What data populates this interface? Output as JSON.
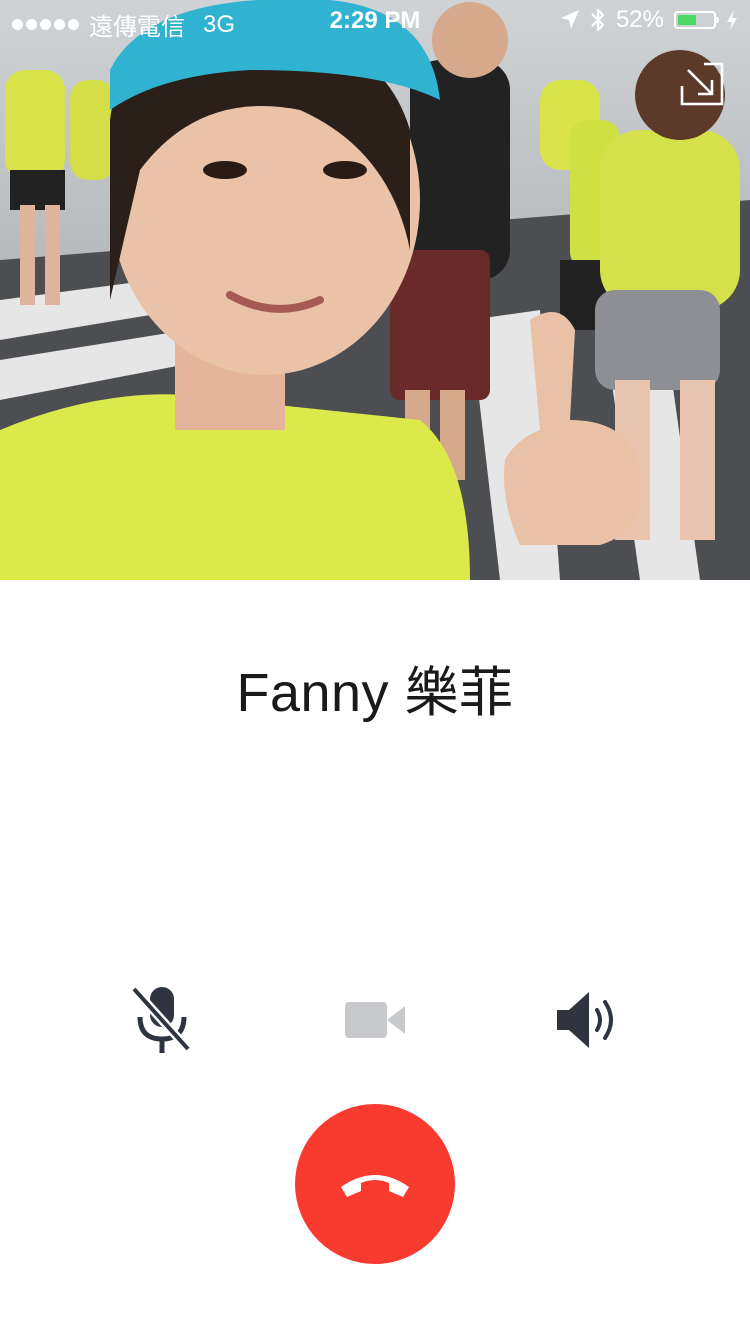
{
  "status_bar": {
    "carrier": "遠傳電信",
    "network": "3G",
    "time": "2:29 PM",
    "battery_percent_label": "52%",
    "battery_level": 0.52,
    "icons": [
      "signal-dots-icon",
      "location-arrow-icon",
      "bluetooth-icon",
      "battery-icon",
      "charging-bolt-icon"
    ]
  },
  "call": {
    "caller_name": "Fanny 樂菲"
  },
  "controls": {
    "mute": {
      "icon": "microphone-muted-icon"
    },
    "video": {
      "icon": "video-camera-icon"
    },
    "speaker": {
      "icon": "speaker-icon"
    },
    "end_call": {
      "icon": "phone-hangup-icon"
    },
    "minimize": {
      "icon": "minimize-arrow-icon"
    }
  },
  "colors": {
    "end_call_red": "#f93a2f",
    "icon_dark": "#2f3540",
    "icon_disabled": "#c7c9cc",
    "battery_green": "#4cd964",
    "text_dark": "#1a1a1a"
  }
}
